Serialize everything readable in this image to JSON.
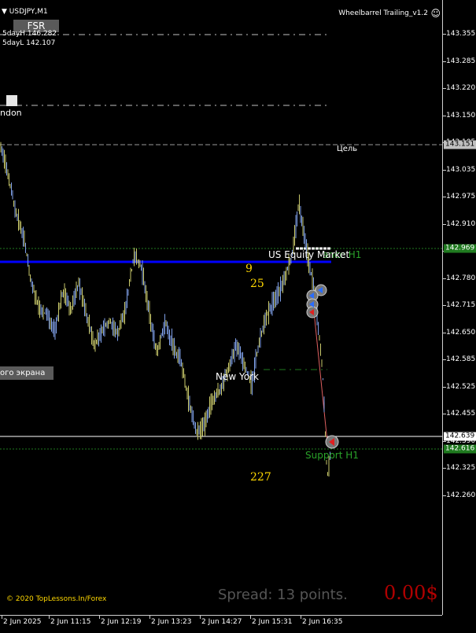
{
  "symbol_label": "USDJPY,M1",
  "fsr_button": "FSR",
  "five_day_high": "5dayH 146.282",
  "five_day_low": "5dayL 142.107",
  "indicator_name": "Wheelbarrel Trailing_v1.2",
  "smiley_glyph": "☺",
  "london_label": "ndon",
  "target_label": "Цель",
  "us_equity_label": "US Equity Market",
  "resistance_label": "ance H1",
  "support_label": "Support H1",
  "new_york_label": "New York",
  "count_9": "9",
  "count_25": "25",
  "count_227": "227",
  "fullscreen_label": "ого экрана",
  "copyright": "© 2020 TopLessons.In/Forex",
  "spread": "Spread: 13 points.",
  "profit": "0.00$",
  "price_ticks": [
    "143.355",
    "143.285",
    "143.220",
    "143.150",
    "143.105",
    "143.035",
    "142.975",
    "142.910",
    "142.845",
    "142.780",
    "142.715",
    "142.650",
    "142.585",
    "142.525",
    "142.455",
    "142.390",
    "142.325",
    "142.260"
  ],
  "price_labels": [
    {
      "text": "143.151",
      "bg": "#c0c0c0",
      "fg": "#000000"
    },
    {
      "text": "142.969",
      "bg": "#1f7a1f",
      "fg": "#ffffff"
    },
    {
      "text": "142.639",
      "bg": "#ffffff",
      "fg": "#000000"
    },
    {
      "text": "142.616",
      "bg": "#1f7a1f",
      "fg": "#ffffff"
    }
  ],
  "time_labels": [
    "2 Jun 2025",
    "2 Jun 11:15",
    "2 Jun 12:19",
    "2 Jun 13:23",
    "2 Jun 14:27",
    "2 Jun 15:31",
    "2 Jun 16:35"
  ],
  "colors": {
    "background": "#000000",
    "candles_up": "#7fa0e8",
    "candles_down": "#c8c86a",
    "blue_line": "#0000ff",
    "green_dotted": "#1f7a1f",
    "profit": "#b00000",
    "counts": "#ffd800"
  }
}
